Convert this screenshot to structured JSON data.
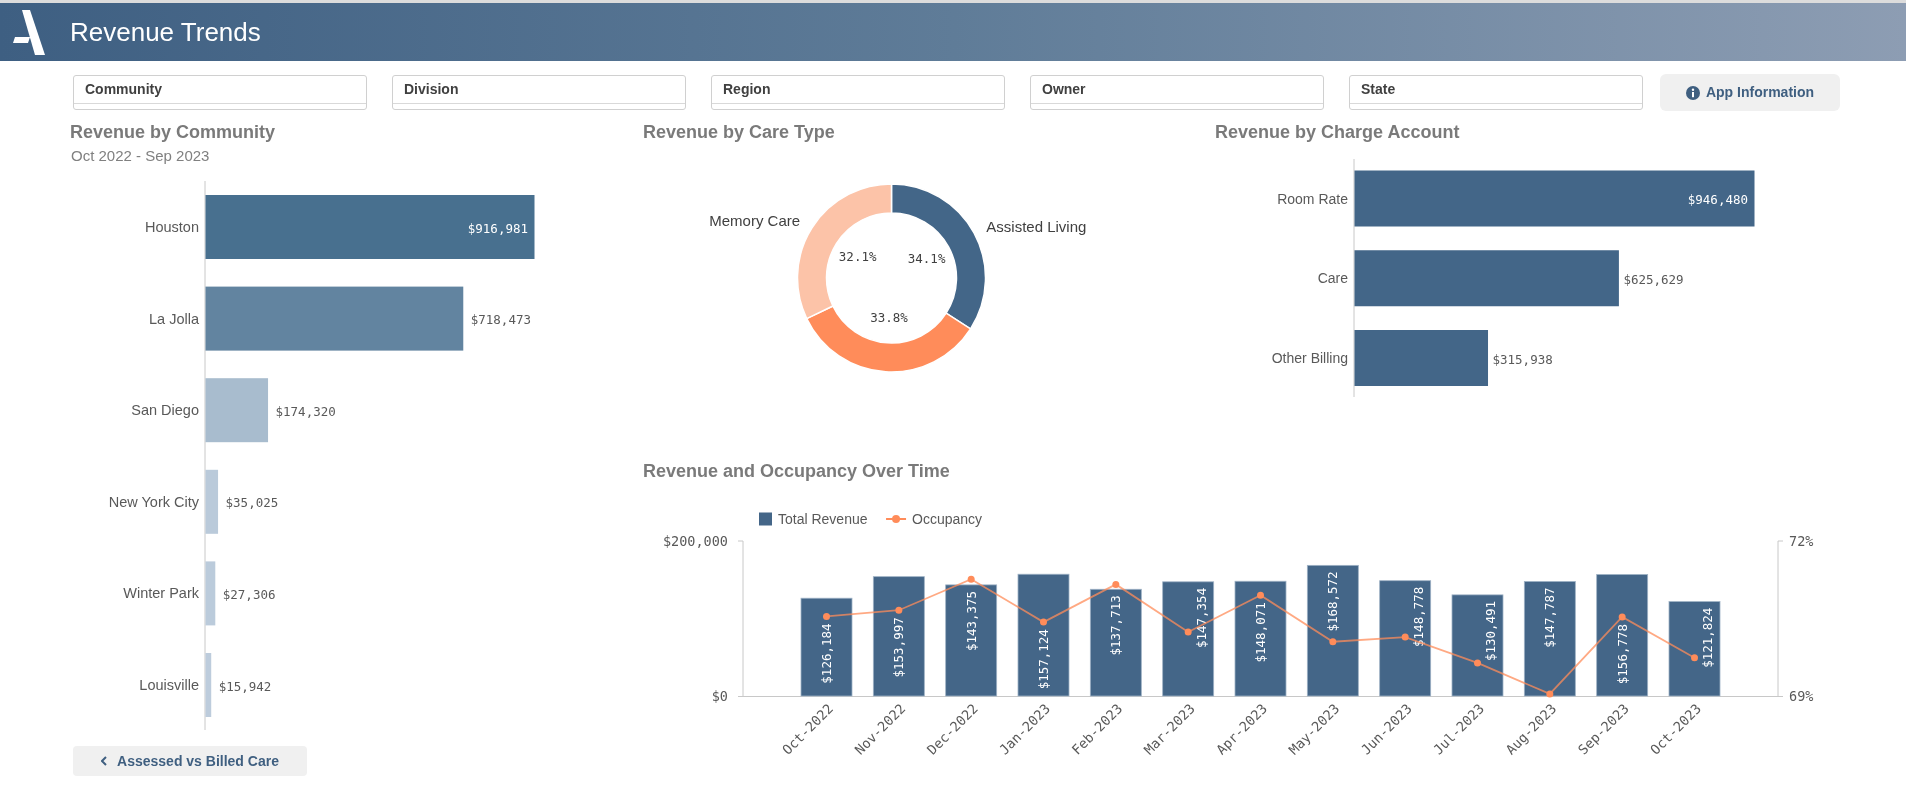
{
  "header": {
    "title": "Revenue Trends"
  },
  "filters": [
    "Community",
    "Division",
    "Region",
    "Owner",
    "State"
  ],
  "app_info_button": {
    "label": "App Information"
  },
  "revenue_by_community": {
    "subtitle": "Oct 2022 - Sep 2023",
    "chart_data": {
      "type": "bar",
      "orientation": "horizontal",
      "title": "Revenue by Community",
      "categories": [
        "Houston",
        "La Jolla",
        "San Diego",
        "New York City",
        "Winter Park",
        "Louisville"
      ],
      "values": [
        916981,
        718473,
        174320,
        35025,
        27306,
        15942
      ],
      "value_labels": [
        "$916,981",
        "$718,473",
        "$174,320",
        "$35,025",
        "$27,306",
        "$15,942"
      ]
    }
  },
  "nav_button": {
    "label": "Assessed vs Billed Care"
  },
  "revenue_by_care_type": {
    "chart_data": {
      "type": "donut",
      "title": "Revenue by Care Type",
      "categories": [
        "Assisted Living",
        null,
        "Memory Care"
      ],
      "values": [
        34.1,
        33.8,
        32.1
      ],
      "value_labels": [
        "34.1%",
        "33.8%",
        "32.1%"
      ]
    }
  },
  "revenue_by_charge_account": {
    "chart_data": {
      "type": "bar",
      "orientation": "horizontal",
      "title": "Revenue by Charge Account",
      "categories": [
        "Room Rate",
        "Care",
        "Other Billing"
      ],
      "values": [
        946480,
        625629,
        315938
      ],
      "value_labels": [
        "$946,480",
        "$625,629",
        "$315,938"
      ]
    }
  },
  "revenue_and_occupancy": {
    "title": "Revenue and Occupancy Over Time",
    "revenue": {
      "chart_data": {
        "type": "bar",
        "categories": [
          "Oct-2022",
          "Nov-2022",
          "Dec-2022",
          "Jan-2023",
          "Feb-2023",
          "Mar-2023",
          "Apr-2023",
          "May-2023",
          "Jun-2023",
          "Jul-2023",
          "Aug-2023",
          "Sep-2023",
          "Oct-2023"
        ],
        "series": [
          {
            "name": "Total Revenue",
            "color": "#446688",
            "values": [
              126184,
              153997,
              143375,
              157124,
              137713,
              147354,
              148071,
              168572,
              148778,
              130491,
              147787,
              156778,
              121824
            ]
          }
        ],
        "value_labels": [
          "$126,184",
          "$153,997",
          "$143,375",
          "$157,124",
          "$137,713",
          "$147,354",
          "$148,071",
          "$168,572",
          "$148,778",
          "$130,491",
          "$147,787",
          "$156,778",
          "$121,824"
        ],
        "ylim": [
          0,
          200000
        ],
        "yticks": [
          {
            "value": 0,
            "label": "$0"
          },
          {
            "value": 200000,
            "label": "$200,000"
          }
        ]
      }
    },
    "occupancy": {
      "chart_data": {
        "type": "line",
        "series": [
          {
            "name": "Occupancy",
            "color": "#ff8c5a",
            "marker": true,
            "values": [
              70.54,
              70.66,
              71.26,
              70.43,
              71.16,
              70.24,
              70.95,
              70.05,
              70.14,
              69.64,
              69.04,
              70.53,
              69.74
            ]
          }
        ],
        "ylim": [
          69,
          72
        ],
        "yticks": [
          {
            "value": 69,
            "label": "69%"
          },
          {
            "value": 72,
            "label": "72%"
          }
        ]
      }
    }
  }
}
